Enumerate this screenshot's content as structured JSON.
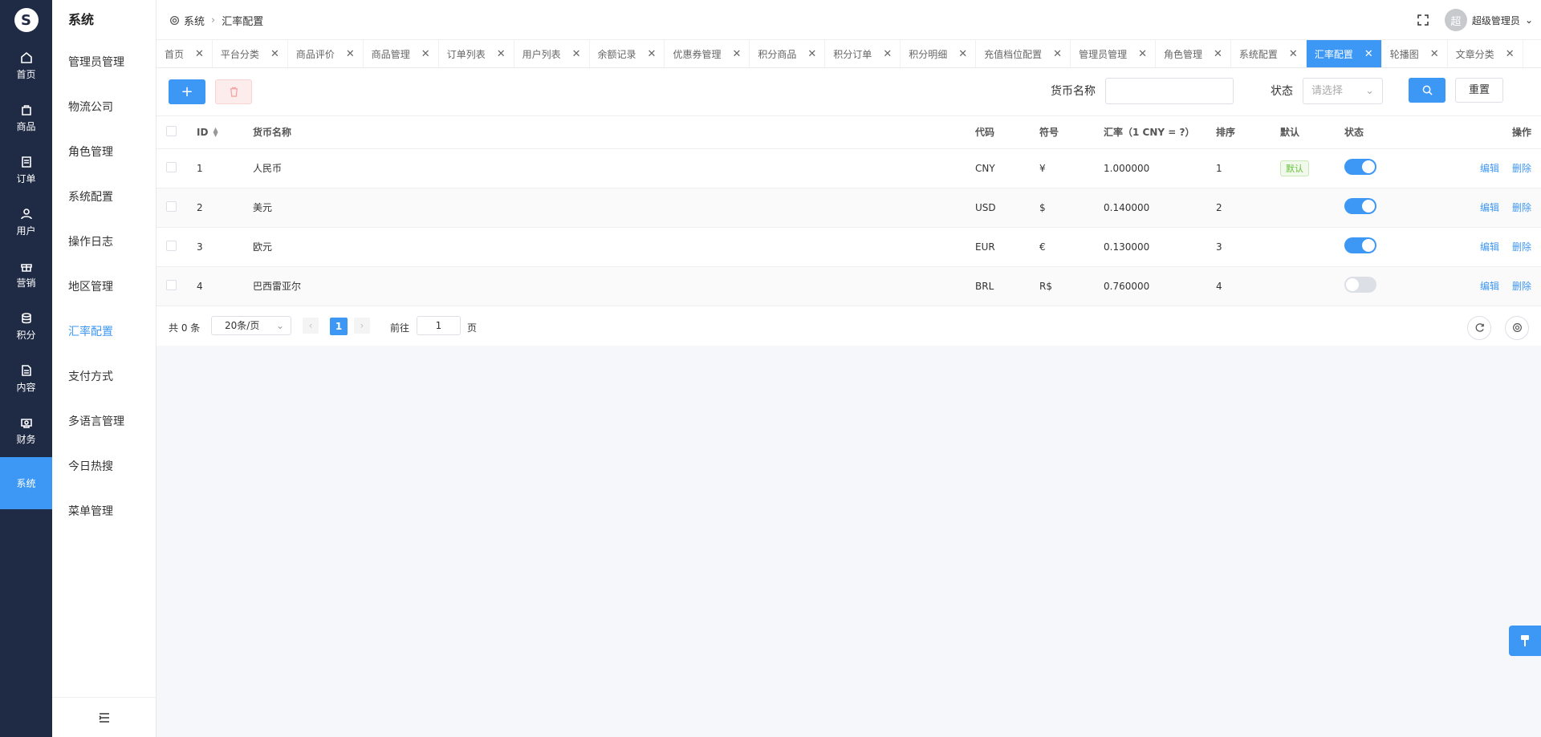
{
  "rail": {
    "logo": "S",
    "items": [
      {
        "label": "首页",
        "icon": "home-icon"
      },
      {
        "label": "商品",
        "icon": "bag-icon"
      },
      {
        "label": "订单",
        "icon": "order-icon"
      },
      {
        "label": "用户",
        "icon": "user-icon"
      },
      {
        "label": "营销",
        "icon": "gift-icon"
      },
      {
        "label": "积分",
        "icon": "coins-icon"
      },
      {
        "label": "内容",
        "icon": "document-icon"
      },
      {
        "label": "财务",
        "icon": "wallet-icon"
      },
      {
        "label": "系统",
        "icon": "system-icon"
      }
    ]
  },
  "subnav": {
    "title": "系统",
    "items": [
      "管理员管理",
      "物流公司",
      "角色管理",
      "系统配置",
      "操作日志",
      "地区管理",
      "汇率配置",
      "支付方式",
      "多语言管理",
      "今日热搜",
      "菜单管理"
    ]
  },
  "header": {
    "breadcrumb_root": "系统",
    "breadcrumb_current": "汇率配置",
    "avatar_text": "超",
    "user_name": "超级管理员"
  },
  "tabs": [
    "首页",
    "平台分类",
    "商品评价",
    "商品管理",
    "订单列表",
    "用户列表",
    "余额记录",
    "优惠券管理",
    "积分商品",
    "积分订单",
    "积分明细",
    "充值档位配置",
    "管理员管理",
    "角色管理",
    "系统配置",
    "汇率配置",
    "轮播图",
    "文章分类"
  ],
  "toolbar": {
    "add_label": "+",
    "currency_label": "货币名称",
    "currency_value": "",
    "status_label": "状态",
    "status_placeholder": "请选择",
    "reset_label": "重置"
  },
  "table": {
    "columns": {
      "id": "ID",
      "name": "货币名称",
      "code": "代码",
      "symbol": "符号",
      "rate": "汇率（1 CNY = ?）",
      "sort": "排序",
      "default": "默认",
      "status": "状态",
      "actions": "操作"
    },
    "rows": [
      {
        "id": "1",
        "name": "人民币",
        "code": "CNY",
        "symbol": "¥",
        "rate": "1.000000",
        "sort": "1",
        "default": "默认",
        "enabled": true
      },
      {
        "id": "2",
        "name": "美元",
        "code": "USD",
        "symbol": "$",
        "rate": "0.140000",
        "sort": "2",
        "default": "",
        "enabled": true
      },
      {
        "id": "3",
        "name": "欧元",
        "code": "EUR",
        "symbol": "€",
        "rate": "0.130000",
        "sort": "3",
        "default": "",
        "enabled": true
      },
      {
        "id": "4",
        "name": "巴西雷亚尔",
        "code": "BRL",
        "symbol": "R$",
        "rate": "0.760000",
        "sort": "4",
        "default": "",
        "enabled": false
      }
    ],
    "edit_label": "编辑",
    "delete_label": "删除"
  },
  "pager": {
    "total": "共 0 条",
    "page_size": "20条/页",
    "current_page": "1",
    "goto_label": "前往",
    "goto_value": "1",
    "page_suffix": "页"
  },
  "colors": {
    "primary": "#3d97f4",
    "rail_bg": "#1f2a44"
  }
}
